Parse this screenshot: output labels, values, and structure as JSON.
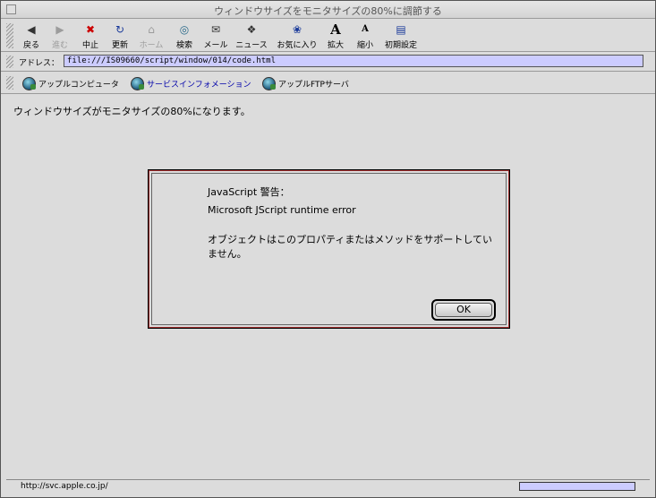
{
  "window": {
    "title": "ウィンドウサイズをモニタサイズの80%に調節する"
  },
  "toolbar": {
    "buttons": [
      {
        "label": "戻る",
        "icon": "back-arrow-icon",
        "glyph": "◀",
        "color": "#333333",
        "enabled": true
      },
      {
        "label": "進む",
        "icon": "forward-arrow-icon",
        "glyph": "▶",
        "color": "#9c9c9c",
        "enabled": false
      },
      {
        "label": "中止",
        "icon": "stop-icon",
        "glyph": "✖",
        "color": "#cc0000",
        "enabled": true
      },
      {
        "label": "更新",
        "icon": "refresh-icon",
        "glyph": "↻",
        "color": "#1a3a9a",
        "enabled": true
      },
      {
        "label": "ホーム",
        "icon": "home-icon",
        "glyph": "⌂",
        "color": "#9c9c9c",
        "enabled": false
      },
      {
        "label": "検索",
        "icon": "search-globe-icon",
        "glyph": "◎",
        "color": "#2a6a8a",
        "enabled": true
      },
      {
        "label": "メール",
        "icon": "mail-icon",
        "glyph": "✉",
        "color": "#333333",
        "enabled": true
      },
      {
        "label": "ニュース",
        "icon": "news-icon",
        "glyph": "❖",
        "color": "#333333",
        "enabled": true
      },
      {
        "label": "お気に入り",
        "icon": "favorites-icon",
        "glyph": "❀",
        "color": "#1a3a9a",
        "enabled": true
      },
      {
        "label": "拡大",
        "icon": "text-larger-icon",
        "glyph": "A",
        "color": "#000000",
        "enabled": true
      },
      {
        "label": "縮小",
        "icon": "text-smaller-icon",
        "glyph": "A",
        "color": "#000000",
        "enabled": true
      },
      {
        "label": "初期設定",
        "icon": "preferences-icon",
        "glyph": "▤",
        "color": "#1a3a9a",
        "enabled": true
      }
    ]
  },
  "address": {
    "label": "アドレス：",
    "value": "file:///IS09660/script/window/014/code.html"
  },
  "favorites": [
    {
      "label": "アップルコンピュータ",
      "active": false
    },
    {
      "label": "サービスインフォメーション",
      "active": true
    },
    {
      "label": "アップルFTPサーバ",
      "active": false
    }
  ],
  "page": {
    "text": "ウィンドウサイズがモニタサイズの80%になります。"
  },
  "dialog": {
    "title": "JavaScript 警告：",
    "error": "Microsoft JScript runtime error",
    "message": "オブジェクトはこのプロパティまたはメソッドをサポートしていません。",
    "ok_label": "OK"
  },
  "status": {
    "text": "http://svc.apple.co.jp/"
  },
  "colors": {
    "address_bg": "#ccccff",
    "favorite_active": "#0000aa",
    "dialog_accent": "#a03030"
  }
}
